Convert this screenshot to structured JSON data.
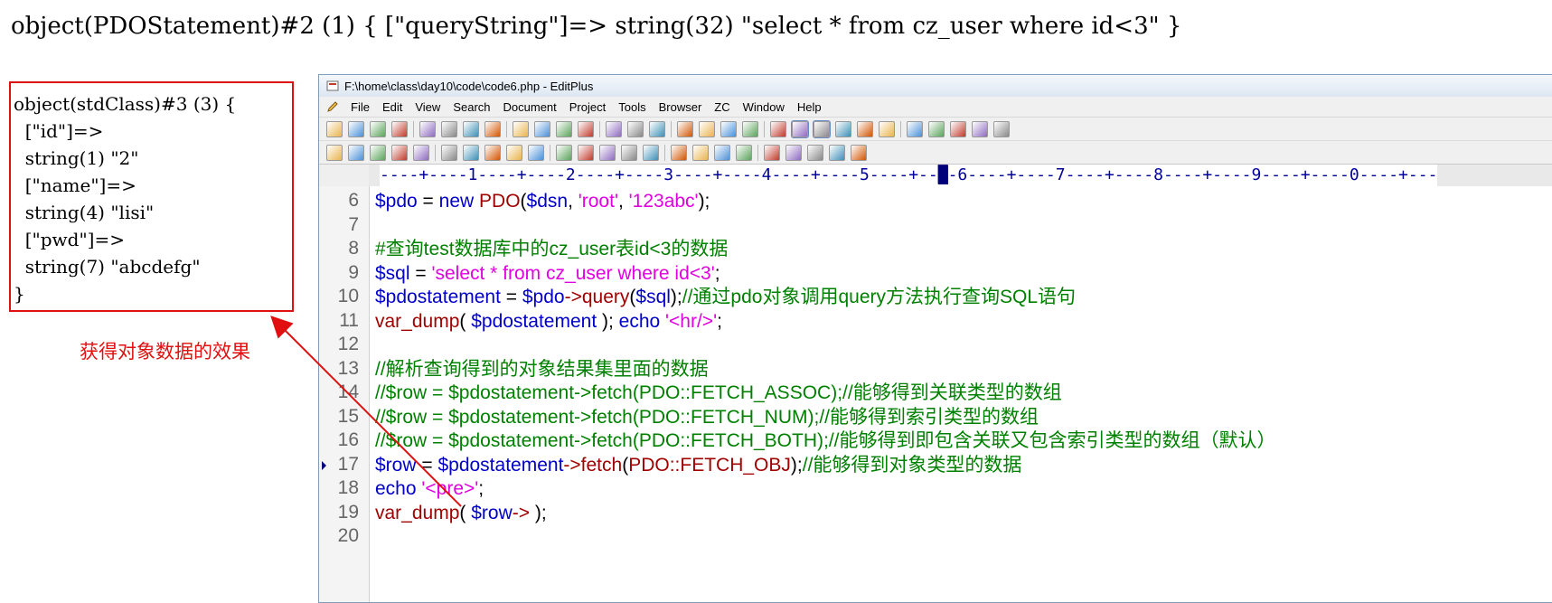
{
  "top_output": "object(PDOStatement)#2 (1) { [\"queryString\"]=> string(32) \"select * from cz_user where id<3\" }",
  "output_box": {
    "lines": [
      "object(stdClass)#3 (3) {",
      "  [\"id\"]=>",
      "  string(1) \"2\"",
      "  [\"name\"]=>",
      "  string(4) \"lisi\"",
      "  [\"pwd\"]=>",
      "  string(7) \"abcdefg\"",
      "}"
    ]
  },
  "caption": "获得对象数据的效果",
  "window": {
    "title": "F:\\home\\class\\day10\\code\\code6.php - EditPlus",
    "menu": [
      "File",
      "Edit",
      "View",
      "Search",
      "Document",
      "Project",
      "Tools",
      "Browser",
      "ZC",
      "Window",
      "Help"
    ],
    "ruler_left": "----+----1----+----2----+----3----+----4----+----5----+--",
    "ruler_right": "-6----+----7----+----8----+----9----+----0----+---"
  },
  "code": {
    "lines": [
      {
        "num": "6",
        "tokens": [
          [
            "var",
            "$pdo"
          ],
          [
            "plain",
            " = "
          ],
          [
            "kw",
            "new "
          ],
          [
            "fn",
            "PDO"
          ],
          [
            "plain",
            "("
          ],
          [
            "var",
            "$dsn"
          ],
          [
            "plain",
            ", "
          ],
          [
            "str",
            "'root'"
          ],
          [
            "plain",
            ", "
          ],
          [
            "str",
            "'123abc'"
          ],
          [
            "plain",
            ");"
          ]
        ]
      },
      {
        "num": "7",
        "tokens": []
      },
      {
        "num": "8",
        "tokens": [
          [
            "cmt",
            "#查询test数据库中的cz_user表id<3的数据"
          ]
        ]
      },
      {
        "num": "9",
        "tokens": [
          [
            "var",
            "$sql"
          ],
          [
            "plain",
            " = "
          ],
          [
            "str",
            "'select * from cz_user where id<3'"
          ],
          [
            "plain",
            ";"
          ]
        ]
      },
      {
        "num": "10",
        "tokens": [
          [
            "var",
            "$pdostatement"
          ],
          [
            "plain",
            " = "
          ],
          [
            "var",
            "$pdo"
          ],
          [
            "fn",
            "->query"
          ],
          [
            "plain",
            "("
          ],
          [
            "var",
            "$sql"
          ],
          [
            "plain",
            ");"
          ],
          [
            "cmt",
            "//通过pdo对象调用query方法执行查询SQL语句"
          ]
        ]
      },
      {
        "num": "11",
        "tokens": [
          [
            "fn",
            "var_dump"
          ],
          [
            "plain",
            "( "
          ],
          [
            "var",
            "$pdostatement"
          ],
          [
            "plain",
            " ); "
          ],
          [
            "kw",
            "echo "
          ],
          [
            "str",
            "'<hr/>'"
          ],
          [
            "plain",
            ";"
          ]
        ]
      },
      {
        "num": "12",
        "tokens": []
      },
      {
        "num": "13",
        "tokens": [
          [
            "cmt",
            "//解析查询得到的对象结果集里面的数据"
          ]
        ]
      },
      {
        "num": "14",
        "tokens": [
          [
            "cmt",
            "//$row = $pdostatement->fetch(PDO::FETCH_ASSOC);//能够得到关联类型的数组"
          ]
        ]
      },
      {
        "num": "15",
        "tokens": [
          [
            "cmt",
            "//$row = $pdostatement->fetch(PDO::FETCH_NUM);//能够得到索引类型的数组"
          ]
        ]
      },
      {
        "num": "16",
        "tokens": [
          [
            "cmt",
            "//$row = $pdostatement->fetch(PDO::FETCH_BOTH);//能够得到即包含关联又包含索引类型的数组（默认）"
          ]
        ]
      },
      {
        "num": "17",
        "tokens": [
          [
            "var",
            "$row"
          ],
          [
            "plain",
            " = "
          ],
          [
            "var",
            "$pdostatement"
          ],
          [
            "fn",
            "->fetch"
          ],
          [
            "plain",
            "("
          ],
          [
            "fn",
            "PDO::FETCH_OBJ"
          ],
          [
            "plain",
            ");"
          ],
          [
            "cmt",
            "//能够得到对象类型的数据"
          ]
        ]
      },
      {
        "num": "18",
        "tokens": [
          [
            "kw",
            "echo "
          ],
          [
            "str",
            "'<pre>'"
          ],
          [
            "plain",
            ";"
          ]
        ]
      },
      {
        "num": "19",
        "tokens": [
          [
            "fn",
            "var_dump"
          ],
          [
            "plain",
            "( "
          ],
          [
            "var",
            "$row"
          ],
          [
            "fn",
            "-> "
          ],
          [
            "plain",
            ");"
          ]
        ]
      },
      {
        "num": "20",
        "tokens": []
      }
    ]
  },
  "colors": {
    "variable": "#0000c8",
    "string": "#e000e0",
    "function": "#a00000",
    "comment": "#008000",
    "annotation_red": "#e01010"
  }
}
